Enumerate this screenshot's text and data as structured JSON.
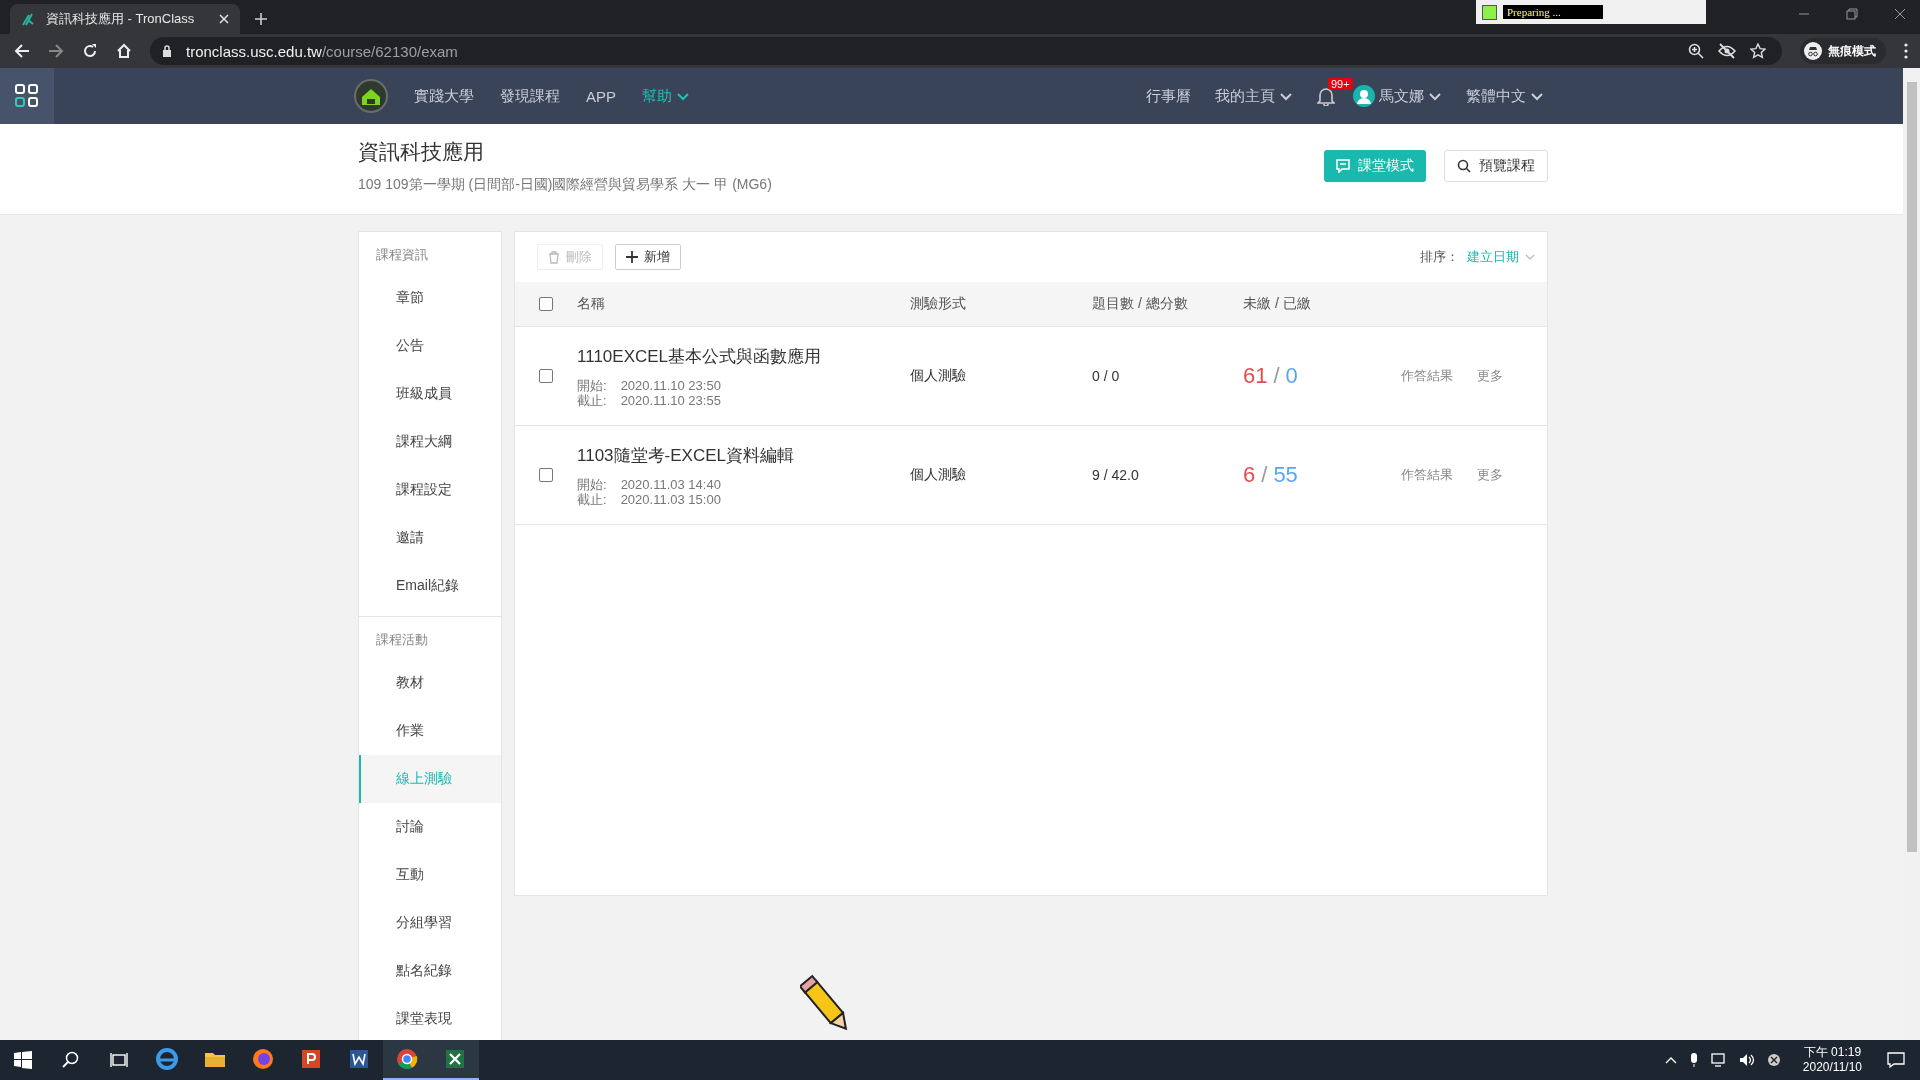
{
  "browser": {
    "tab_title": "資訊科技應用 - TronClass",
    "url_host": "tronclass.usc.edu.tw",
    "url_path": "/course/62130/exam",
    "profile": "無痕模式",
    "recorder": "Preparing ..."
  },
  "nav": {
    "school": "實踐大學",
    "left": [
      {
        "label": "發現課程",
        "dropdown": false,
        "selected": false
      },
      {
        "label": "APP",
        "dropdown": false,
        "selected": false
      },
      {
        "label": "幫助",
        "dropdown": true,
        "selected": true
      }
    ],
    "right": [
      {
        "kind": "link",
        "label": "行事曆",
        "dropdown": false
      },
      {
        "kind": "link",
        "label": "我的主頁",
        "dropdown": true
      },
      {
        "kind": "bell",
        "badge": "99+"
      },
      {
        "kind": "user",
        "label": "馬文娜",
        "dropdown": true
      },
      {
        "kind": "link",
        "label": "繁體中文",
        "dropdown": true
      }
    ]
  },
  "header": {
    "title": "資訊科技應用",
    "subtitle": "109 109第一學期 (日間部-日國)國際經營與貿易學系 大一 甲 (MG6)",
    "buttons": [
      {
        "kind": "primary",
        "label": "課堂模式"
      },
      {
        "kind": "outline",
        "label": "預覽課程"
      }
    ]
  },
  "sidebar": {
    "sections": [
      {
        "heading": "課程資訊",
        "items": [
          {
            "label": "章節",
            "selected": false
          },
          {
            "label": "公告",
            "selected": false
          },
          {
            "label": "班級成員",
            "selected": false
          },
          {
            "label": "課程大綱",
            "selected": false
          },
          {
            "label": "課程設定",
            "selected": false
          },
          {
            "label": "邀請",
            "selected": false
          },
          {
            "label": "Email紀錄",
            "selected": false
          }
        ]
      },
      {
        "heading": "課程活動",
        "items": [
          {
            "label": "教材",
            "selected": false
          },
          {
            "label": "作業",
            "selected": false
          },
          {
            "label": "線上測驗",
            "selected": true
          },
          {
            "label": "討論",
            "selected": false
          },
          {
            "label": "互動",
            "selected": false
          },
          {
            "label": "分組學習",
            "selected": false
          },
          {
            "label": "點名紀錄",
            "selected": false
          },
          {
            "label": "課堂表現",
            "selected": false
          }
        ]
      }
    ]
  },
  "toolbar": {
    "delete": {
      "label": "刪除",
      "disabled": true
    },
    "add": {
      "label": "新增"
    },
    "sort_label": "排序：",
    "sort_value": "建立日期"
  },
  "table": {
    "header_checked": false,
    "columns": [
      "名稱",
      "測驗形式",
      "題目數 / 總分數",
      "未繳 / 已繳"
    ],
    "rows": [
      {
        "checked": false,
        "name": "1110EXCEL基本公式與函數應用",
        "start_label": "開始:",
        "start": "2020.11.10 23:50",
        "end_label": "截止:",
        "end": "2020.11.10 23:55",
        "type": "個人測驗",
        "questions": "0 / 0",
        "unsubmitted": "61",
        "count_separator": "/",
        "submitted": "0",
        "actions": [
          "作答結果",
          "更多"
        ]
      },
      {
        "checked": false,
        "name": "1103隨堂考-EXCEL資料編輯",
        "start_label": "開始:",
        "start": "2020.11.03 14:40",
        "end_label": "截止:",
        "end": "2020.11.03 15:00",
        "type": "個人測驗",
        "questions": "9 / 42.0",
        "unsubmitted": "6",
        "count_separator": "/",
        "submitted": "55",
        "actions": [
          "作答結果",
          "更多"
        ]
      }
    ]
  },
  "taskbar": {
    "apps": [
      {
        "kind": "edge",
        "running": false
      },
      {
        "kind": "folder",
        "running": false
      },
      {
        "kind": "firefox",
        "running": false
      },
      {
        "kind": "powerpoint",
        "running": false
      },
      {
        "kind": "word",
        "running": false
      },
      {
        "kind": "chrome",
        "running": true
      },
      {
        "kind": "excel",
        "running": true
      }
    ],
    "time": "下午 01:19",
    "date": "2020/11/10"
  }
}
